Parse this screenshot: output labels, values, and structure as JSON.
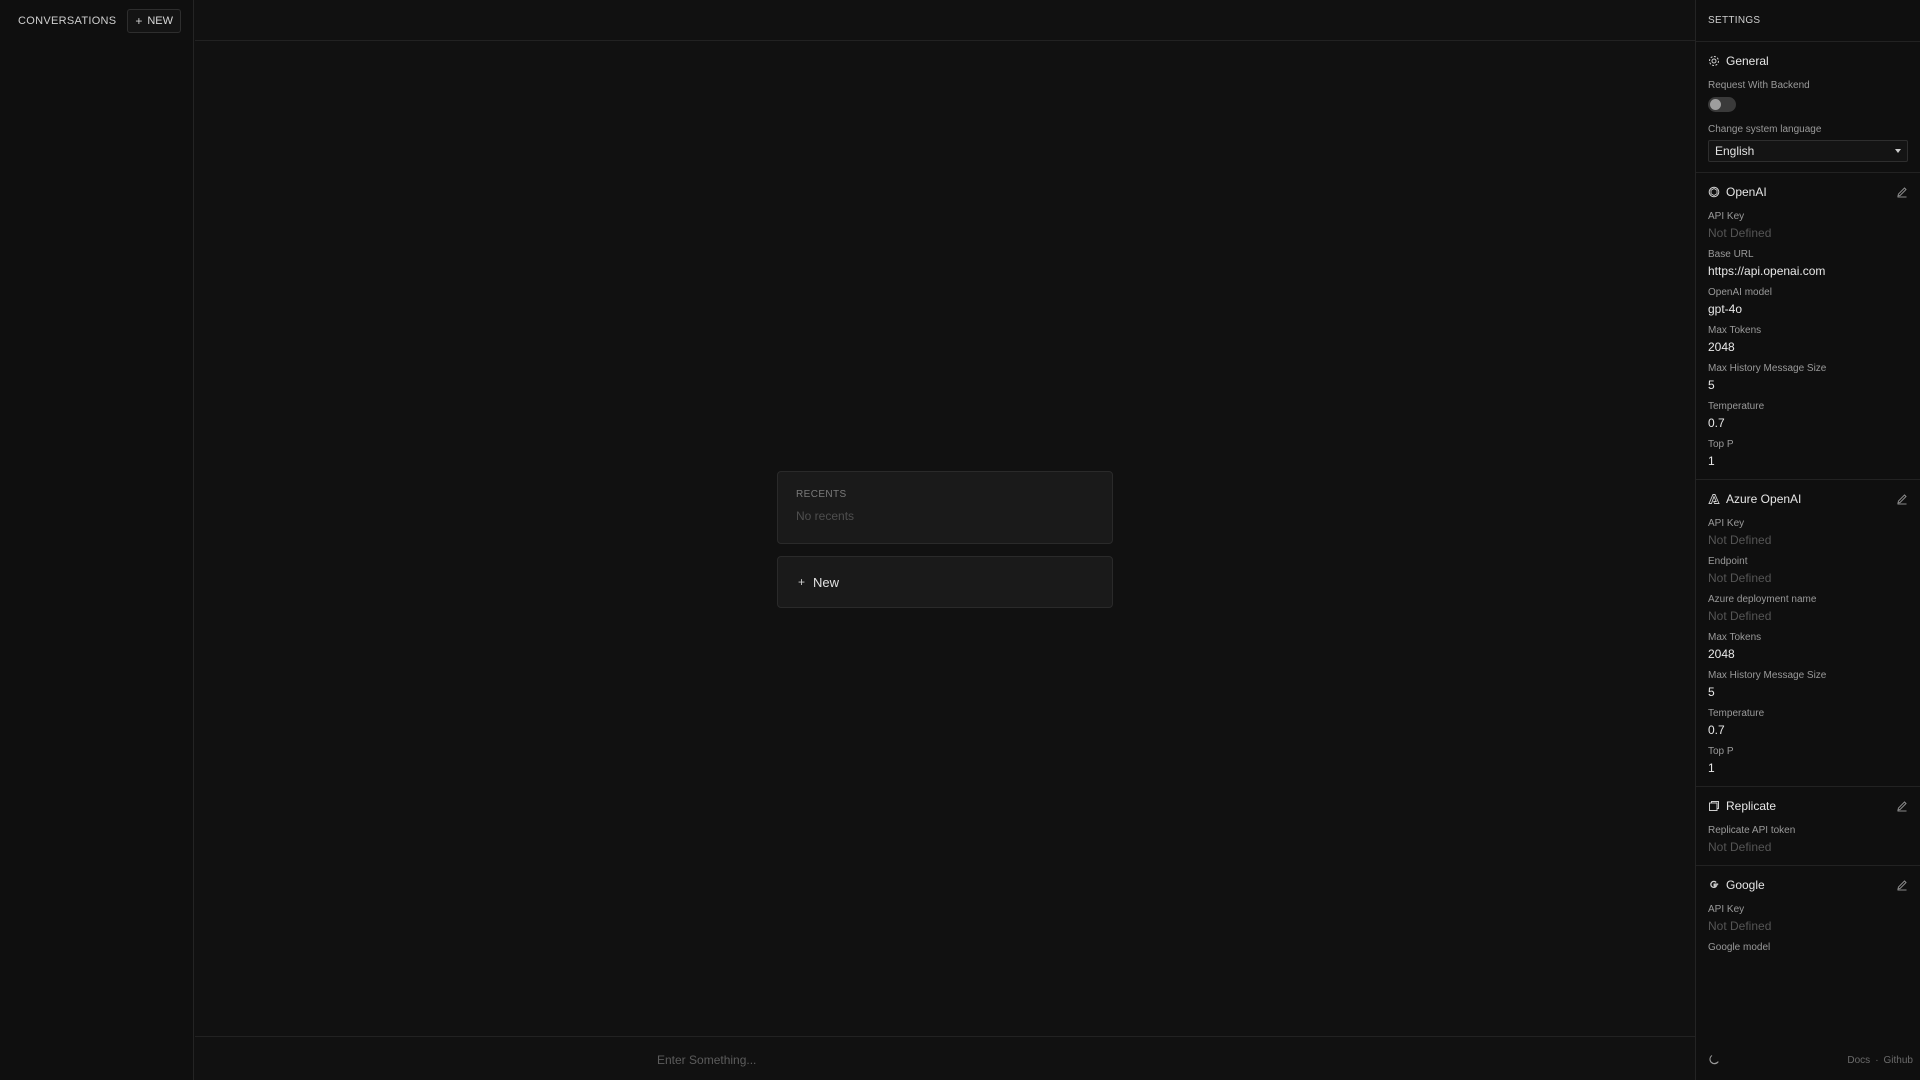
{
  "left": {
    "title": "CONVERSATIONS",
    "new_label": "NEW"
  },
  "main": {
    "recents_title": "RECENTS",
    "recents_empty": "No recents",
    "new_label": "New",
    "input_placeholder": "Enter Something..."
  },
  "settings": {
    "title": "SETTINGS",
    "general": {
      "title": "General",
      "request_backend_label": "Request With Backend",
      "request_backend_on": false,
      "language_label": "Change system language",
      "language_value": "English"
    },
    "openai": {
      "title": "OpenAI",
      "fields": [
        {
          "label": "API Key",
          "value": "Not Defined",
          "muted": true
        },
        {
          "label": "Base URL",
          "value": "https://api.openai.com",
          "muted": false
        },
        {
          "label": "OpenAI model",
          "value": "gpt-4o",
          "muted": false
        },
        {
          "label": "Max Tokens",
          "value": "2048",
          "muted": false
        },
        {
          "label": "Max History Message Size",
          "value": "5",
          "muted": false
        },
        {
          "label": "Temperature",
          "value": "0.7",
          "muted": false
        },
        {
          "label": "Top P",
          "value": "1",
          "muted": false
        }
      ]
    },
    "azure": {
      "title": "Azure OpenAI",
      "fields": [
        {
          "label": "API Key",
          "value": "Not Defined",
          "muted": true
        },
        {
          "label": "Endpoint",
          "value": "Not Defined",
          "muted": true
        },
        {
          "label": "Azure deployment name",
          "value": "Not Defined",
          "muted": true
        },
        {
          "label": "Max Tokens",
          "value": "2048",
          "muted": false
        },
        {
          "label": "Max History Message Size",
          "value": "5",
          "muted": false
        },
        {
          "label": "Temperature",
          "value": "0.7",
          "muted": false
        },
        {
          "label": "Top P",
          "value": "1",
          "muted": false
        }
      ]
    },
    "replicate": {
      "title": "Replicate",
      "fields": [
        {
          "label": "Replicate API token",
          "value": "Not Defined",
          "muted": true
        }
      ]
    },
    "google": {
      "title": "Google",
      "fields": [
        {
          "label": "API Key",
          "value": "Not Defined",
          "muted": true
        },
        {
          "label": "Google model",
          "value": "",
          "muted": false
        }
      ]
    },
    "footer": {
      "docs": "Docs",
      "separator": "·",
      "github": "Github"
    }
  },
  "colors": {
    "background": "#111111",
    "panel": "#0f0f0f",
    "card": "#1a1a1a",
    "border": "#242424",
    "muted_text": "#555555"
  }
}
